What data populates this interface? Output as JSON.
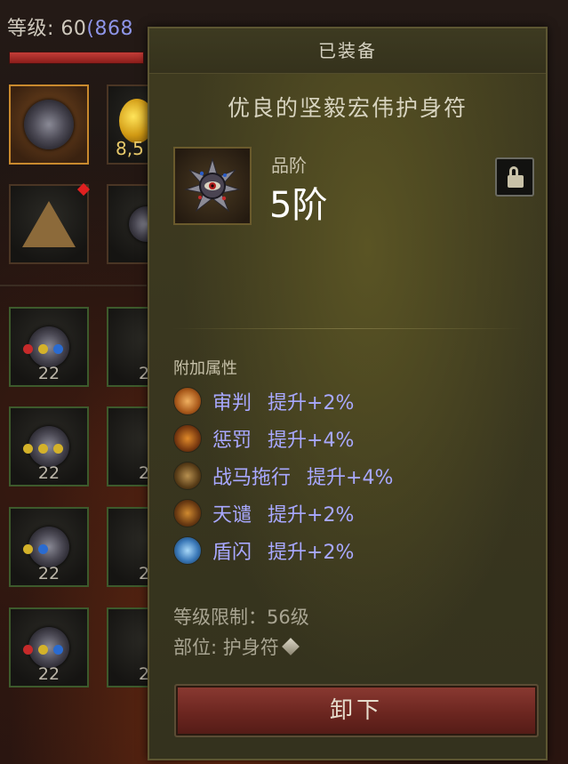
{
  "player": {
    "level_label": "等级: ",
    "level_value": "60",
    "level_sub": "(868"
  },
  "inventory": {
    "gold_amount": "8,5",
    "slot_counts": [
      "22",
      "22",
      "22",
      "22"
    ],
    "clipped_counts": [
      "2",
      "2",
      "2",
      "2"
    ]
  },
  "tooltip": {
    "header": "已装备",
    "item_name": "优良的坚毅宏伟护身符",
    "grade_label": "品阶",
    "grade_value": "5阶",
    "attributes_title": "附加属性",
    "attributes": [
      {
        "skill": "审判",
        "bonus": "提升+2%",
        "icon": "judgment-icon",
        "color": "#d4863a"
      },
      {
        "skill": "惩罚",
        "bonus": "提升+4%",
        "icon": "punishment-icon",
        "color": "#c8731e"
      },
      {
        "skill": "战马拖行",
        "bonus": "提升+4%",
        "icon": "warhorse-drag-icon",
        "color": "#8c6a2a"
      },
      {
        "skill": "天谴",
        "bonus": "提升+2%",
        "icon": "wrath-icon",
        "color": "#a8621a"
      },
      {
        "skill": "盾闪",
        "bonus": "提升+2%",
        "icon": "shield-flash-icon",
        "color": "#4a90c8"
      }
    ],
    "level_requirement": "等级限制：56级",
    "slot": "部位: 护身符",
    "unequip_label": "卸下"
  },
  "colors": {
    "attribute_text": "#a8a8ff",
    "unequip_button": "#6c2620",
    "panel_bg": "#3a371f"
  }
}
